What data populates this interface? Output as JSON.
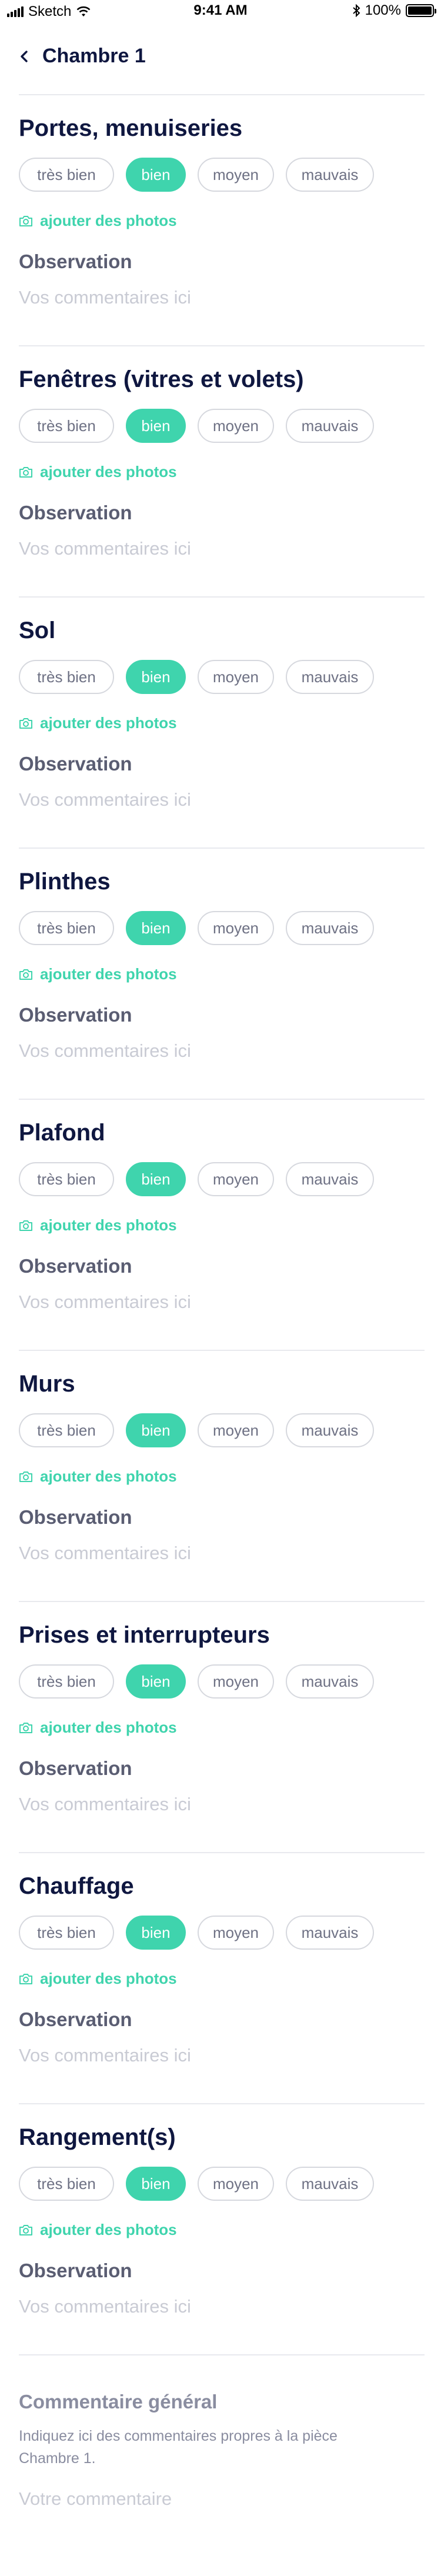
{
  "status_bar": {
    "carrier": "Sketch",
    "time": "9:41 AM",
    "battery": "100%",
    "battery_level": 1.0
  },
  "header": {
    "title": "Chambre 1",
    "back_icon": "chevron-left-icon"
  },
  "rating_options": [
    "très bien",
    "bien",
    "moyen",
    "mauvais"
  ],
  "photo_label": "ajouter des photos",
  "photo_icon": "camera-icon",
  "observation_label": "Observation",
  "observation_placeholder": "Vos commentaires ici",
  "accent_color": "#3fd4ad",
  "sections": [
    {
      "title": "Portes, menuiseries",
      "selected": "bien"
    },
    {
      "title": "Fenêtres (vitres et volets)",
      "selected": "bien"
    },
    {
      "title": "Sol",
      "selected": "bien"
    },
    {
      "title": "Plinthes",
      "selected": "bien"
    },
    {
      "title": "Plafond",
      "selected": "bien"
    },
    {
      "title": "Murs",
      "selected": "bien"
    },
    {
      "title": "Prises et interrupteurs",
      "selected": "bien"
    },
    {
      "title": "Chauffage",
      "selected": "bien"
    },
    {
      "title": "Rangement(s)",
      "selected": "bien"
    }
  ],
  "general_comment": {
    "title": "Commentaire général",
    "description": "Indiquez ici des commentaires propres à la pièce Chambre 1.",
    "placeholder": "Votre commentaire"
  }
}
